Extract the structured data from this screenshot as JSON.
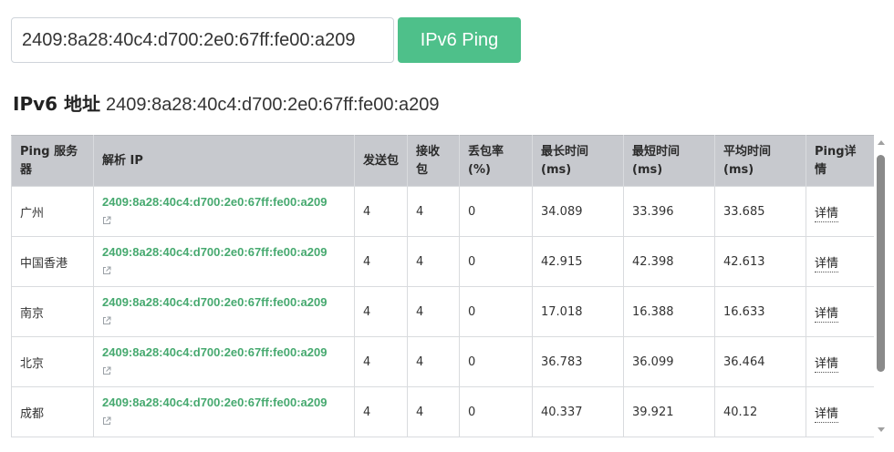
{
  "form": {
    "ip_value": "2409:8a28:40c4:d700:2e0:67ff:fe00:a209",
    "button_label": "IPv6 Ping"
  },
  "heading": {
    "label": "IPv6 地址",
    "ip": "2409:8a28:40c4:d700:2e0:67ff:fe00:a209"
  },
  "table": {
    "headers": [
      "Ping 服务器",
      "解析 IP",
      "发送包",
      "接收包",
      "丢包率(%)",
      "最长时间(ms)",
      "最短时间(ms)",
      "平均时间(ms)",
      "Ping详情"
    ],
    "rows": [
      {
        "server": "广州",
        "ip": "2409:8a28:40c4:d700:2e0:67ff:fe00:a209",
        "sent": "4",
        "received": "4",
        "loss": "0",
        "max": "34.089",
        "min": "33.396",
        "avg": "33.685",
        "detail": "详情"
      },
      {
        "server": "中国香港",
        "ip": "2409:8a28:40c4:d700:2e0:67ff:fe00:a209",
        "sent": "4",
        "received": "4",
        "loss": "0",
        "max": "42.915",
        "min": "42.398",
        "avg": "42.613",
        "detail": "详情"
      },
      {
        "server": "南京",
        "ip": "2409:8a28:40c4:d700:2e0:67ff:fe00:a209",
        "sent": "4",
        "received": "4",
        "loss": "0",
        "max": "17.018",
        "min": "16.388",
        "avg": "16.633",
        "detail": "详情"
      },
      {
        "server": "北京",
        "ip": "2409:8a28:40c4:d700:2e0:67ff:fe00:a209",
        "sent": "4",
        "received": "4",
        "loss": "0",
        "max": "36.783",
        "min": "36.099",
        "avg": "36.464",
        "detail": "详情"
      },
      {
        "server": "成都",
        "ip": "2409:8a28:40c4:d700:2e0:67ff:fe00:a209",
        "sent": "4",
        "received": "4",
        "loss": "0",
        "max": "40.337",
        "min": "39.921",
        "avg": "40.12",
        "detail": "详情"
      }
    ]
  },
  "icons": {
    "external_link": "external-link-icon"
  },
  "colors": {
    "accent": "#4ec08a",
    "link": "#46a96f",
    "header_bg": "#c7c9ce"
  }
}
